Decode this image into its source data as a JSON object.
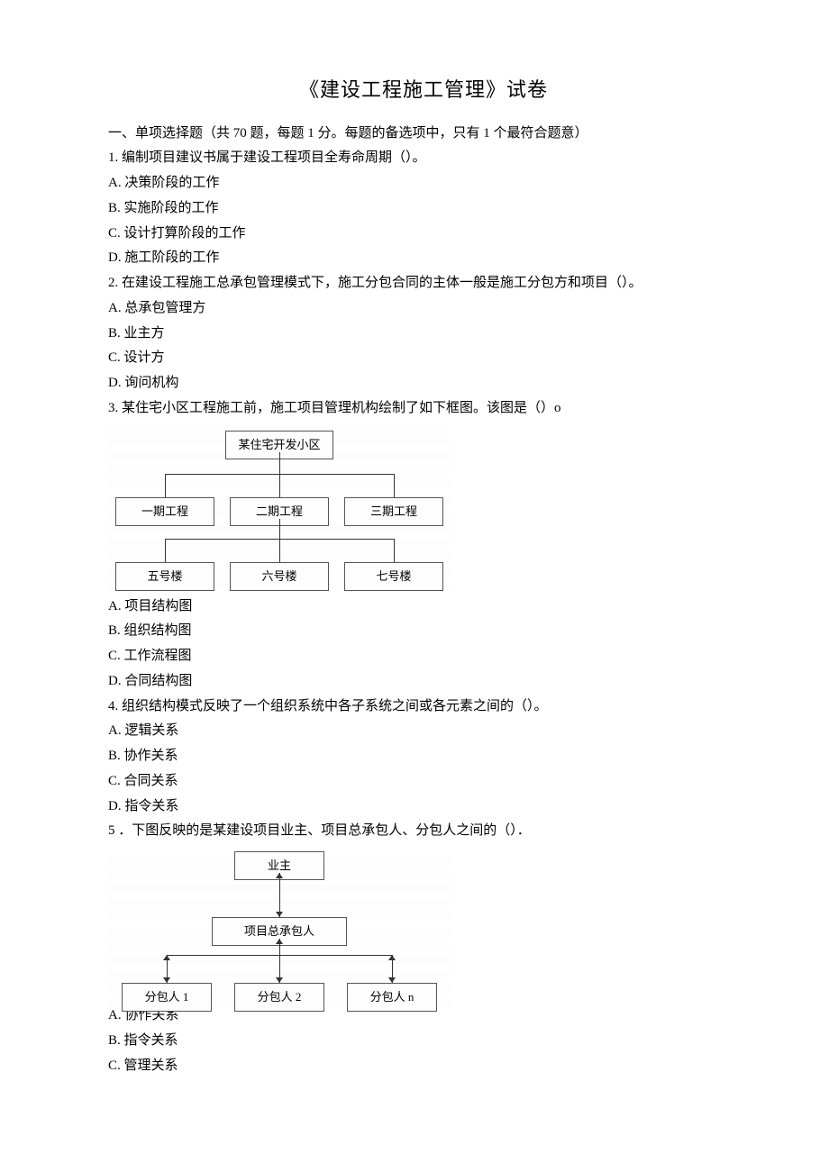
{
  "title": "《建设工程施工管理》试卷",
  "section1_header": "一、单项选择题（共 70 题，每题 1 分。每题的备选项中，只有 1 个最符合题意）",
  "q1": {
    "stem": "1. 编制项目建议书属于建设工程项目全寿命周期（）。",
    "a": "A. 决策阶段的工作",
    "b": "B. 实施阶段的工作",
    "c": "C. 设计打算阶段的工作",
    "d": "D. 施工阶段的工作"
  },
  "q2": {
    "stem": "2. 在建设工程施工总承包管理模式下，施工分包合同的主体一般是施工分包方和项目（）。",
    "a": "A. 总承包管理方",
    "b": "B. 业主方",
    "c": "C. 设计方",
    "d": "D. 询问机构"
  },
  "q3": {
    "stem": "3. 某住宅小区工程施工前，施工项目管理机构绘制了如下框图。该图是（）o",
    "a": "A. 项目结构图",
    "b": "B. 组织结构图",
    "c": "C. 工作流程图",
    "d": "D. 合同结构图",
    "diagram": {
      "root": "某住宅开发小区",
      "level1": [
        "一期工程",
        "二期工程",
        "三期工程"
      ],
      "level2": [
        "五号楼",
        "六号楼",
        "七号楼"
      ]
    }
  },
  "q4": {
    "stem": "4. 组织结构模式反映了一个组织系统中各子系统之间或各元素之间的（）。",
    "a": "A. 逻辑关系",
    "b": "B. 协作关系",
    "c": "C. 合同关系",
    "d": "D. 指令关系"
  },
  "q5": {
    "stem": "5 ．下图反映的是某建设项目业主、项目总承包人、分包人之间的（）．",
    "a": "A. 协作关系",
    "b": "B. 指令关系",
    "c": "C. 管理关系",
    "diagram": {
      "top": "业主",
      "mid": "项目总承包人",
      "bottom": [
        "分包人 1",
        "分包人 2",
        "分包人 n"
      ]
    }
  }
}
